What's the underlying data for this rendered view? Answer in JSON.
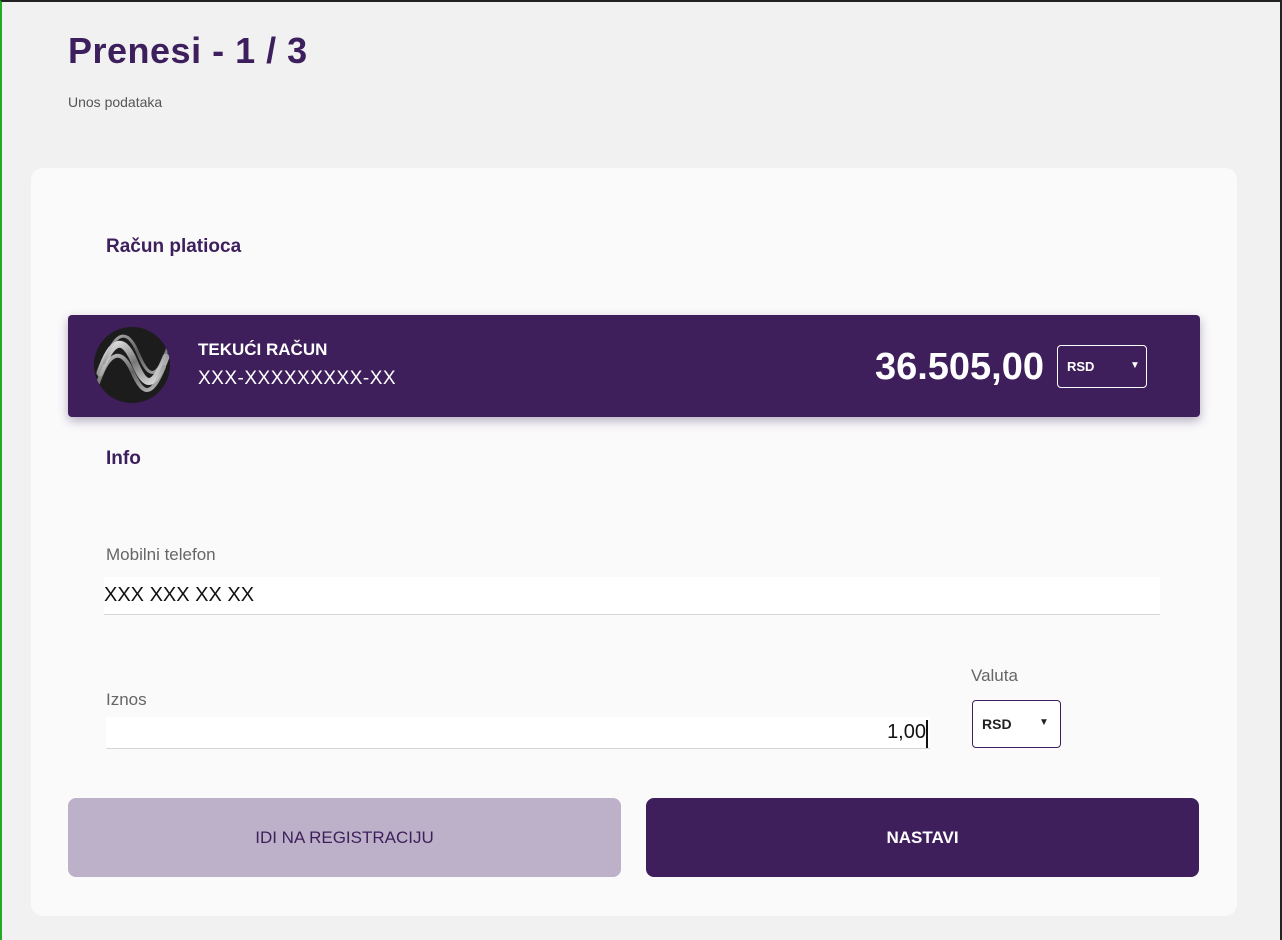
{
  "header": {
    "title": "Prenesi - 1 / 3",
    "subtitle": "Unos podataka"
  },
  "payer_section": {
    "label": "Račun platioca",
    "account": {
      "logo_icon": "bank-logo-icon",
      "name": "TEKUĆI RAČUN",
      "number": "XXX-XXXXXXXXX-XX",
      "balance": "36.505,00",
      "currency": "RSD"
    }
  },
  "info_section": {
    "label": "Info",
    "phone": {
      "label": "Mobilni telefon",
      "value": "XXX XXX XX XX"
    },
    "amount": {
      "label": "Iznos",
      "value": "1,00"
    },
    "currency": {
      "label": "Valuta",
      "value": "RSD"
    }
  },
  "actions": {
    "register_label": "IDI NA REGISTRACIJU",
    "continue_label": "NASTAVI"
  },
  "colors": {
    "brand": "#3e1f5b",
    "brand_muted": "#bcb1c8",
    "background": "#f1f1f1"
  }
}
